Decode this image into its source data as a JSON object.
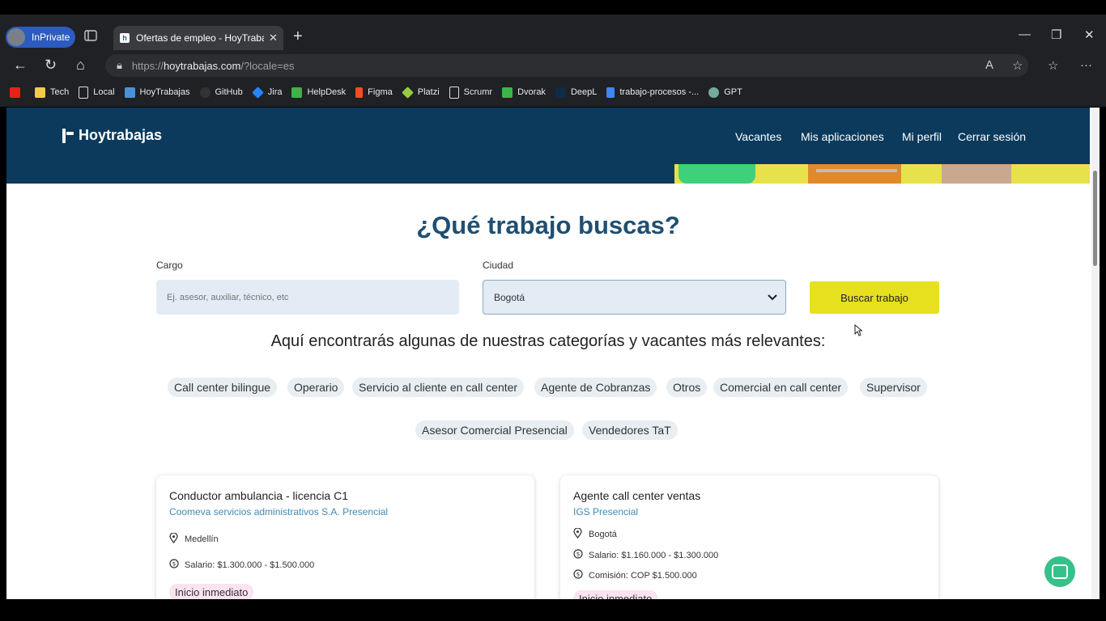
{
  "browser": {
    "profile_label": "InPrivate",
    "tab_title": "Ofertas de empleo - HoyTrabajas",
    "url_prefix": "https://",
    "url_host": "hoytrabajas.com",
    "url_path": "/?locale=es"
  },
  "bookmarks": [
    {
      "label": "",
      "icon": "youtube-icon",
      "color": "#e62117"
    },
    {
      "label": "Tech",
      "icon": "folder-icon",
      "color": "#f2c94c"
    },
    {
      "label": "Local",
      "icon": "page-icon",
      "color": "#dddddd"
    },
    {
      "label": "HoyTrabajas",
      "icon": "hoytrabajas-icon",
      "color": "#4a90d9"
    },
    {
      "label": "GitHub",
      "icon": "github-icon",
      "color": "#333333"
    },
    {
      "label": "Jira",
      "icon": "jira-icon",
      "color": "#2684ff"
    },
    {
      "label": "HelpDesk",
      "icon": "helpdesk-icon",
      "color": "#3cb44b"
    },
    {
      "label": "Figma",
      "icon": "figma-icon",
      "color": "#f24e1e"
    },
    {
      "label": "Platzi",
      "icon": "platzi-icon",
      "color": "#98ca3f"
    },
    {
      "label": "Scrumr",
      "icon": "page-icon",
      "color": "#dddddd"
    },
    {
      "label": "Dvorak",
      "icon": "dvorak-icon",
      "color": "#3cb44b"
    },
    {
      "label": "DeepL",
      "icon": "deepl-icon",
      "color": "#0f2b46"
    },
    {
      "label": "trabajo-procesos -...",
      "icon": "docs-icon",
      "color": "#4285f4"
    },
    {
      "label": "GPT",
      "icon": "gpt-icon",
      "color": "#74aa9c"
    }
  ],
  "site": {
    "logo_text": "Hoytrabajas",
    "nav": [
      "Vacantes",
      "Mis aplicaciones",
      "Mi perfil",
      "Cerrar sesión"
    ],
    "hero_title": "¿Qué trabajo buscas?",
    "cargo_label": "Cargo",
    "cargo_placeholder": "Ej. asesor, auxiliar, técnico, etc",
    "ciudad_label": "Ciudad",
    "ciudad_value": "Bogotá",
    "search_button": "Buscar trabajo",
    "categories_title": "Aquí encontrarás algunas de nuestras categorías y vacantes más relevantes:",
    "categories": [
      "Call center bilingue",
      "Operario",
      "Servicio al cliente en call center",
      "Agente de Cobranzas",
      "Otros",
      "Comercial en call center",
      "Supervisor",
      "Asesor Comercial Presencial",
      "Vendedores TaT"
    ],
    "jobs": [
      {
        "title": "Conductor ambulancia - licencia C1",
        "company": "Coomeva servicios administrativos S.A. Presencial",
        "city": "Medellín",
        "salary": "Salario: $1.300.000 - $1.500.000",
        "badge": "Inicio inmediato"
      },
      {
        "title": "Agente call center ventas",
        "company": "IGS Presencial",
        "city": "Bogotá",
        "salary": "Salario: $1.160.000 - $1.300.000",
        "commission": "Comisión: COP $1.500.000",
        "badge": "Inicio inmediato"
      }
    ]
  }
}
